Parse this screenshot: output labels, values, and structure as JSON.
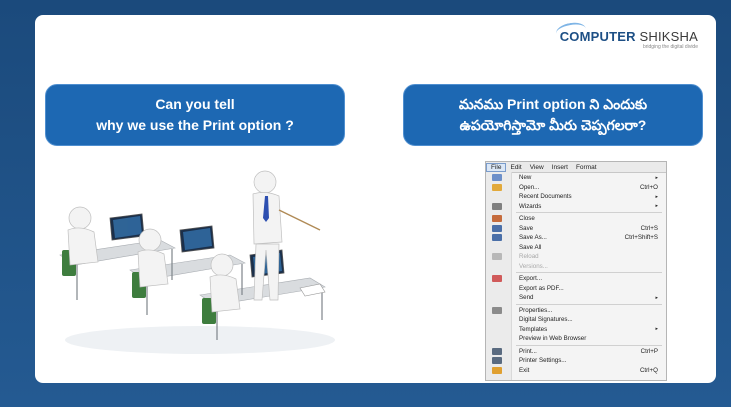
{
  "logo": {
    "brand_main": "COMPUTER",
    "brand_rest": " SHIKSHA",
    "tagline": "bridging the digital divide"
  },
  "question_en": {
    "line1": "Can you tell",
    "line2": "why we use the Print option ?"
  },
  "question_te": {
    "line1": "మనము Print option ని ఎందుకు",
    "line2": "ఉపయోగిస్తామో మీరు చెప్పగలరా?"
  },
  "menu": {
    "bar": [
      "File",
      "Edit",
      "View",
      "Insert",
      "Format"
    ],
    "items": [
      {
        "label": "New",
        "shortcut": "",
        "arrow": true,
        "icon": "new-doc-icon",
        "color": "#6c8fc9"
      },
      {
        "label": "Open...",
        "shortcut": "Ctrl+O",
        "arrow": false,
        "icon": "folder-icon",
        "color": "#e2a93a"
      },
      {
        "label": "Recent Documents",
        "shortcut": "",
        "arrow": true,
        "icon": "",
        "color": ""
      },
      {
        "label": "Wizards",
        "shortcut": "",
        "arrow": true,
        "icon": "wizard-icon",
        "color": "#7f7f7f"
      },
      {
        "label": "Close",
        "shortcut": "",
        "arrow": false,
        "icon": "close-doc-icon",
        "color": "#c56b3c"
      },
      {
        "label": "Save",
        "shortcut": "Ctrl+S",
        "arrow": false,
        "icon": "save-icon",
        "color": "#4a6fa8"
      },
      {
        "label": "Save As...",
        "shortcut": "Ctrl+Shift+S",
        "arrow": false,
        "icon": "save-as-icon",
        "color": "#4a6fa8"
      },
      {
        "label": "Save All",
        "shortcut": "",
        "arrow": false,
        "icon": "",
        "color": ""
      },
      {
        "label": "Reload",
        "shortcut": "",
        "arrow": false,
        "icon": "reload-icon",
        "color": "#b8b8b8",
        "disabled": true
      },
      {
        "label": "Versions...",
        "shortcut": "",
        "arrow": false,
        "icon": "",
        "color": "",
        "disabled": true
      },
      {
        "label": "Export...",
        "shortcut": "",
        "arrow": false,
        "icon": "export-icon",
        "color": "#d05a5a"
      },
      {
        "label": "Export as PDF...",
        "shortcut": "",
        "arrow": false,
        "icon": "",
        "color": ""
      },
      {
        "label": "Send",
        "shortcut": "",
        "arrow": true,
        "icon": "",
        "color": ""
      },
      {
        "label": "Properties...",
        "shortcut": "",
        "arrow": false,
        "icon": "properties-icon",
        "color": "#8b8b8b"
      },
      {
        "label": "Digital Signatures...",
        "shortcut": "",
        "arrow": false,
        "icon": "",
        "color": ""
      },
      {
        "label": "Templates",
        "shortcut": "",
        "arrow": true,
        "icon": "",
        "color": ""
      },
      {
        "label": "Preview in Web Browser",
        "shortcut": "",
        "arrow": false,
        "icon": "",
        "color": ""
      },
      {
        "label": "Print...",
        "shortcut": "Ctrl+P",
        "arrow": false,
        "icon": "print-icon",
        "color": "#5a6b80"
      },
      {
        "label": "Printer Settings...",
        "shortcut": "",
        "arrow": false,
        "icon": "printer-settings-icon",
        "color": "#5a6b80"
      },
      {
        "label": "Exit",
        "shortcut": "Ctrl+Q",
        "arrow": false,
        "icon": "exit-icon",
        "color": "#e0a030"
      }
    ],
    "separators_after": [
      3,
      9,
      12,
      16
    ]
  }
}
